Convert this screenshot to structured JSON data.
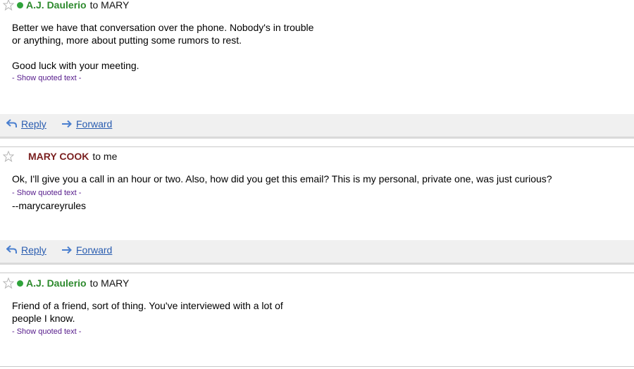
{
  "messages": [
    {
      "sender": "A.J. Daulerio",
      "recipient": "to MARY",
      "body": "Better we have that conversation over the phone. Nobody's in trouble\nor anything, more about putting some rumors to rest.\n\nGood luck with your meeting.",
      "quoted_link": "- Show quoted text -",
      "actions": {
        "reply": "Reply",
        "forward": "Forward"
      }
    },
    {
      "sender": "MARY COOK",
      "recipient": "to me",
      "body": "Ok, I'll give you a call in an hour or two. Also, how did you get this email? This is my personal, private one, was just curious?",
      "quoted_link": "- Show quoted text -",
      "signature": "--marycareyrules",
      "actions": {
        "reply": "Reply",
        "forward": "Forward"
      }
    },
    {
      "sender": "A.J. Daulerio",
      "recipient": "to MARY",
      "body": "Friend of a friend, sort of thing. You've interviewed with a lot of\npeople I know.",
      "quoted_link": "- Show quoted text -"
    }
  ],
  "colors": {
    "sender_green": "#2d8a2d",
    "sender_maroon": "#7a1f1f",
    "presence_green": "#2ea33a",
    "link_blue": "#2a5db0",
    "quoted_purple": "#551a8b",
    "action_bar_bg": "#f0f0f0"
  },
  "icons": {
    "star": "star-outline-icon",
    "presence": "online-status-icon",
    "reply": "reply-arrow-icon",
    "forward": "forward-arrow-icon"
  }
}
